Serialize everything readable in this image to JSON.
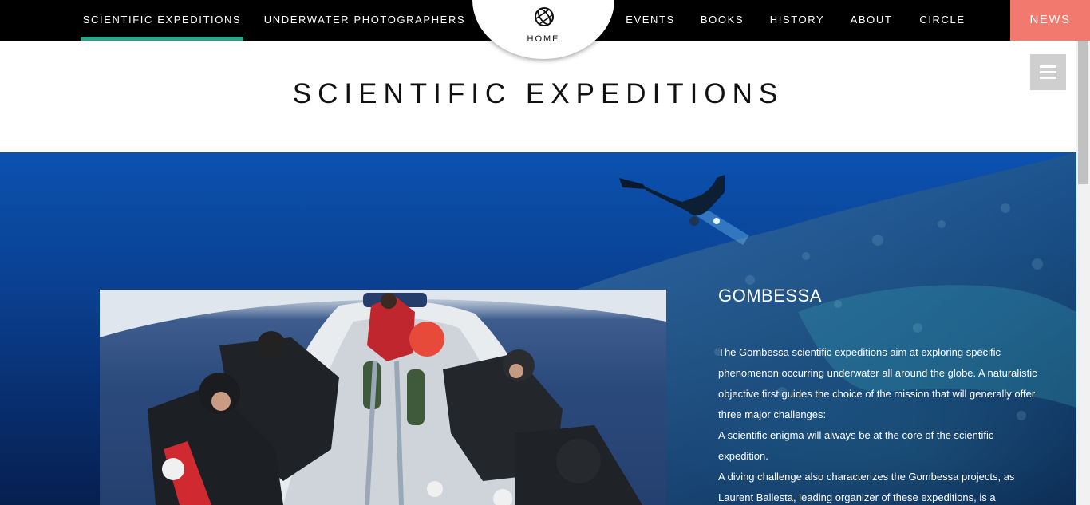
{
  "nav": {
    "left_items": [
      {
        "label": "SCIENTIFIC EXPEDITIONS",
        "active": true
      },
      {
        "label": "UNDERWATER PHOTOGRAPHERS",
        "active": false
      }
    ],
    "home": {
      "label": "HOME",
      "icon": "globe-icon"
    },
    "right_items": [
      {
        "label": "EVENTS"
      },
      {
        "label": "BOOKS"
      },
      {
        "label": "HISTORY"
      },
      {
        "label": "ABOUT"
      },
      {
        "label": "CIRCLE"
      }
    ],
    "news_label": "NEWS"
  },
  "header": {
    "title": "SCIENTIFIC EXPEDITIONS",
    "menu_icon": "hamburger-menu-icon"
  },
  "feature": {
    "title": "GOMBESSA",
    "paragraphs": [
      "The Gombessa scientific expeditions aim at exploring specific phenomenon occurring underwater all around the globe. A naturalistic objective first guides the choice of the mission that will generally offer three major challenges:",
      "A scientific enigma will always be at the core of the scientific expedition.",
      "A diving challenge also characterizes the Gombessa projects, as Laurent Ballesta, leading organizer of these expeditions, is a"
    ]
  },
  "colors": {
    "nav_background": "#000000",
    "active_underline": "#2aa58c",
    "news_background": "#f2796d",
    "menu_button": "#cfcfcf"
  }
}
